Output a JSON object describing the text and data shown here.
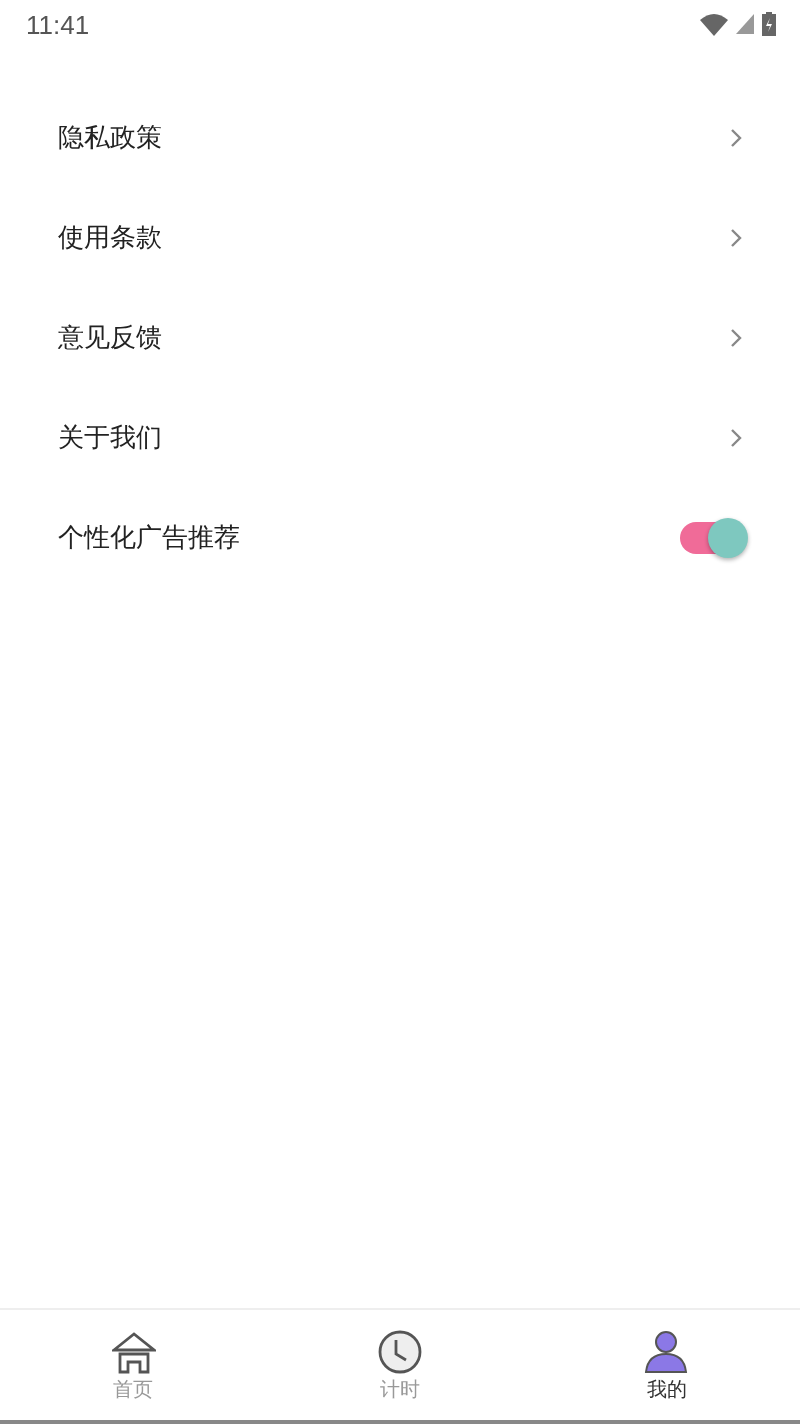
{
  "status_bar": {
    "time": "11:41"
  },
  "menu": [
    {
      "kind": "link",
      "label": "隐私政策"
    },
    {
      "kind": "link",
      "label": "使用条款"
    },
    {
      "kind": "link",
      "label": "意见反馈"
    },
    {
      "kind": "link",
      "label": "关于我们"
    },
    {
      "kind": "toggle",
      "label": "个性化广告推荐",
      "on": true
    }
  ],
  "tabs": [
    {
      "kind": "home",
      "label": "首页",
      "selected": false
    },
    {
      "kind": "clock",
      "label": "计时",
      "selected": false
    },
    {
      "kind": "person",
      "label": "我的",
      "selected": true
    }
  ]
}
